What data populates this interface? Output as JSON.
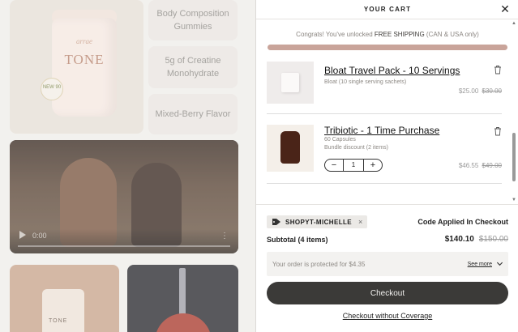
{
  "background_page": {
    "product_brand": "arrae",
    "product_name": "TONE",
    "product_badge": "NEW 90",
    "features": [
      "Body Composition Gummies",
      "5g of Creatine Monohydrate",
      "Mixed-Berry Flavor"
    ],
    "video_time": "0:00",
    "tile_label": "TONE"
  },
  "cart": {
    "title": "YOUR CART",
    "shipping_prefix": "Congrats! You've unlocked ",
    "shipping_highlight": "FREE SHIPPING",
    "shipping_suffix": " (CAN & USA only)",
    "shipping_progress_percent": 100,
    "items": [
      {
        "name": "Bloat Travel Pack - 10 Servings",
        "subtitle": "Bloat (10 single serving sachets)",
        "price": "$25.00",
        "compare_price": "$30.00"
      },
      {
        "name": "Tribiotic - 1 Time Purchase",
        "subtitle": "60 Capsules",
        "subtitle2": "Bundle discount (2 items)",
        "quantity": "1",
        "price": "$46.55",
        "compare_price": "$49.00"
      }
    ],
    "qty_minus": "−",
    "qty_plus": "+"
  },
  "footer": {
    "coupon_code": "SHOPYT-MICHELLE",
    "coupon_remove": "×",
    "code_applied": "Code Applied In Checkout",
    "subtotal_label": "Subtotal (4 items)",
    "subtotal_price": "$140.10",
    "subtotal_compare": "$150.00",
    "protection_text": "Your order is protected for $4.35",
    "see_more": "See more",
    "checkout_label": "Checkout",
    "checkout_without_coverage": "Checkout without Coverage"
  },
  "colors": {
    "progress_bar": "#c9a49a",
    "checkout_button": "#3b3a38"
  },
  "icons": {
    "close": "close-icon",
    "trash": "trash-icon",
    "tag": "tag-icon",
    "chevron": "chevron-down-icon"
  }
}
